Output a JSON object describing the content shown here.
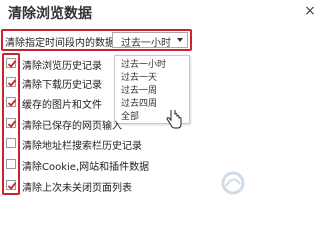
{
  "dialog": {
    "title": "清除浏览数据",
    "close_glyph": "×"
  },
  "range": {
    "label": "清除指定时间段内的数据：",
    "selected": "过去一小时",
    "options": [
      "过去一小时",
      "过去一天",
      "过去一周",
      "过去四周",
      "全部"
    ]
  },
  "items": [
    {
      "label": "清除浏览历史记录",
      "checked": true
    },
    {
      "label": "清除下载历史记录",
      "checked": true
    },
    {
      "label": "缓存的图片和文件",
      "checked": true
    },
    {
      "label": "清除已保存的网页输入",
      "checked": true
    },
    {
      "label": "清除地址栏搜索栏历史记录",
      "checked": false
    },
    {
      "label": "清除Cookie,网站和插件数据",
      "checked": false
    },
    {
      "label": "清除上次未关闭页面列表",
      "checked": true
    }
  ],
  "colors": {
    "highlight": "#c8242b",
    "check": "#c8242b"
  },
  "icons": {
    "close": "close-icon",
    "dropdown": "chevron-down-icon",
    "cursor": "hand-pointer-icon",
    "checkbox": "checkmark-icon",
    "watermark": "watermark-logo"
  }
}
